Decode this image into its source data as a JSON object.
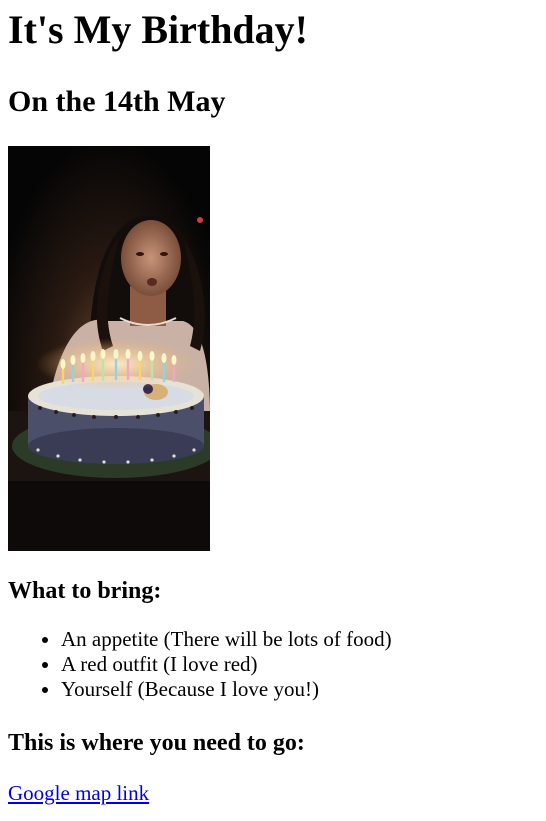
{
  "page": {
    "title": "It's My Birthday!",
    "subtitle": "On the 14th May"
  },
  "photo": {
    "icon": "birthday-photo-icon"
  },
  "bring": {
    "heading": "What to bring:",
    "items": [
      "An appetite (There will be lots of food)",
      "A red outfit (I love red)",
      "Yourself (Because I love you!)"
    ]
  },
  "location": {
    "heading": "This is where you need to go:",
    "link_text": "Google map link"
  },
  "colors": {
    "link": "#0000ee",
    "text": "#000000",
    "background": "#ffffff"
  }
}
